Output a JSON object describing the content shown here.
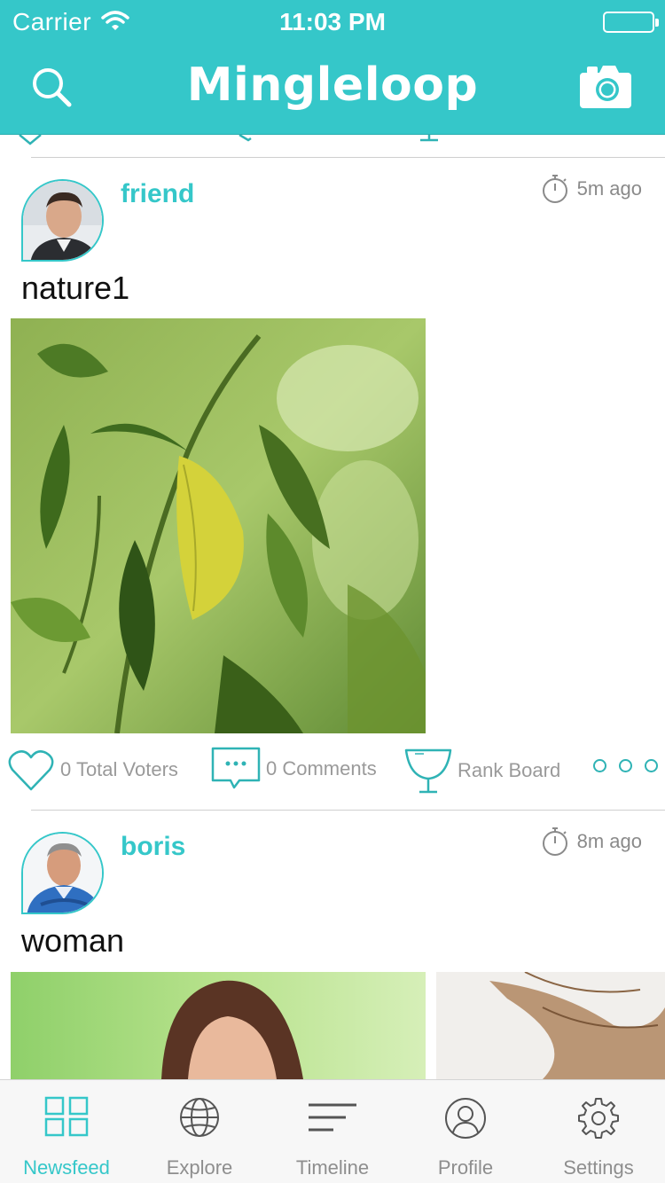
{
  "status_bar": {
    "carrier": "Carrier",
    "time": "11:03 PM"
  },
  "header": {
    "title": "Mingleloop",
    "left_icon": "search-icon",
    "right_icon": "camera-icon"
  },
  "posts": [
    {
      "username": "friend",
      "time_ago": "5m ago",
      "title": "nature1",
      "image": "leaves-photo",
      "actions": {
        "voters": "0 Total Voters",
        "comments": "0 Comments",
        "rank": "Rank Board"
      }
    },
    {
      "username": "boris",
      "time_ago": "8m ago",
      "title": "woman",
      "images": [
        "woman-photo-1",
        "woman-photo-2"
      ]
    }
  ],
  "tabbar": {
    "items": [
      {
        "label": "Newsfeed",
        "icon": "grid-icon",
        "active": true
      },
      {
        "label": "Explore",
        "icon": "globe-icon",
        "active": false
      },
      {
        "label": "Timeline",
        "icon": "lines-icon",
        "active": false
      },
      {
        "label": "Profile",
        "icon": "person-icon",
        "active": false
      },
      {
        "label": "Settings",
        "icon": "gear-icon",
        "active": false
      }
    ]
  },
  "colors": {
    "accent": "#35c7c9",
    "muted": "#9a9a9a",
    "tab_bg": "#f7f7f7"
  }
}
